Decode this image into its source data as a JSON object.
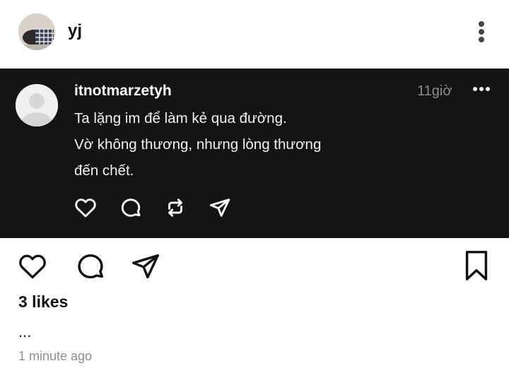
{
  "header": {
    "username": "yj"
  },
  "embedded_post": {
    "username": "itnotmarzetyh",
    "time": "11giờ",
    "lines": [
      "Ta lặng im để làm kẻ qua đường.",
      "Vờ không thương, nhưng lòng thương",
      "đến chết."
    ]
  },
  "post": {
    "likes": "3 likes",
    "caption": "...",
    "time_ago": "1 minute ago"
  },
  "colors": {
    "embed_background": "#141414",
    "embed_time": "#8c8c8c",
    "timestamp_gray": "#8e8e8e"
  }
}
